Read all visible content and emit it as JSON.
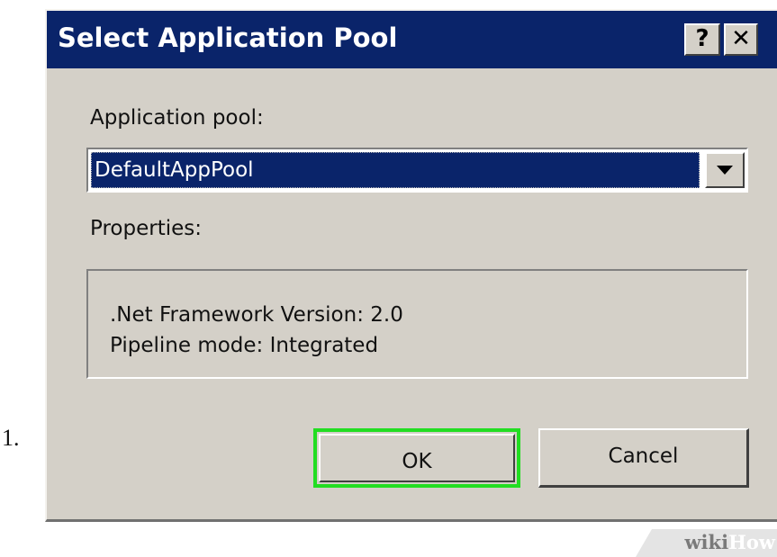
{
  "step_number": "1.",
  "dialog": {
    "title": "Select Application Pool",
    "help_button": "?",
    "close_button": "✕",
    "pool_label": "Application pool:",
    "pool_selected": "DefaultAppPool",
    "properties_label": "Properties:",
    "properties": {
      "framework": ".Net Framework Version: 2.0",
      "pipeline": "Pipeline mode: Integrated"
    },
    "ok_label": "OK",
    "cancel_label": "Cancel"
  },
  "watermark": {
    "part1": "wiki",
    "part2": "How"
  },
  "colors": {
    "titlebar": "#0a246a",
    "dialog_face": "#d4d0c8",
    "ok_highlight": "#22dd22"
  },
  "icons": [
    "help-icon",
    "close-icon",
    "chevron-down-icon"
  ]
}
